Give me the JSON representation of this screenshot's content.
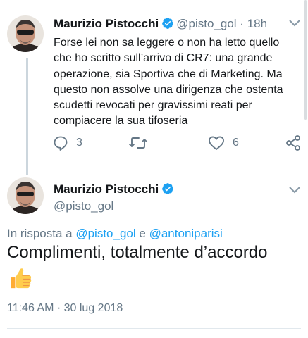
{
  "tweet1": {
    "author_name": "Maurizio Pistocchi",
    "handle": "@pisto_gol",
    "separator": "·",
    "time": "18h",
    "text": "Forse lei non sa leggere o non ha letto quello che ho scritto sull’arrivo di CR7: una grande operazione, sia Sportiva che di Marketing. Ma questo non assolve una dirigenza che ostenta scudetti revocati per gravissimi reati per compiacere la sua tifoseria",
    "reply_count": "3",
    "retweet_count": "",
    "like_count": "6",
    "icons": [
      "verified-badge-icon",
      "chevron-down-icon",
      "reply-icon",
      "retweet-icon",
      "heart-icon",
      "share-icon"
    ]
  },
  "tweet2": {
    "author_name": "Maurizio Pistocchi",
    "handle": "@pisto_gol",
    "replying_prefix": "In risposta a",
    "replying_to_1": "@pisto_gol",
    "replying_conj": "e",
    "replying_to_2": "@antoniparisi",
    "text": "Complimenti, totalmente d’accordo",
    "emoji": "thumbs-up",
    "timestamp": "11:46 AM · 30 lug 2018"
  },
  "colors": {
    "text_primary": "#14171a",
    "text_secondary": "#657786",
    "link": "#1da1f2",
    "verified": "#1da1f2",
    "thread_line": "#ccd6dd",
    "divider": "#e1e8ed"
  }
}
